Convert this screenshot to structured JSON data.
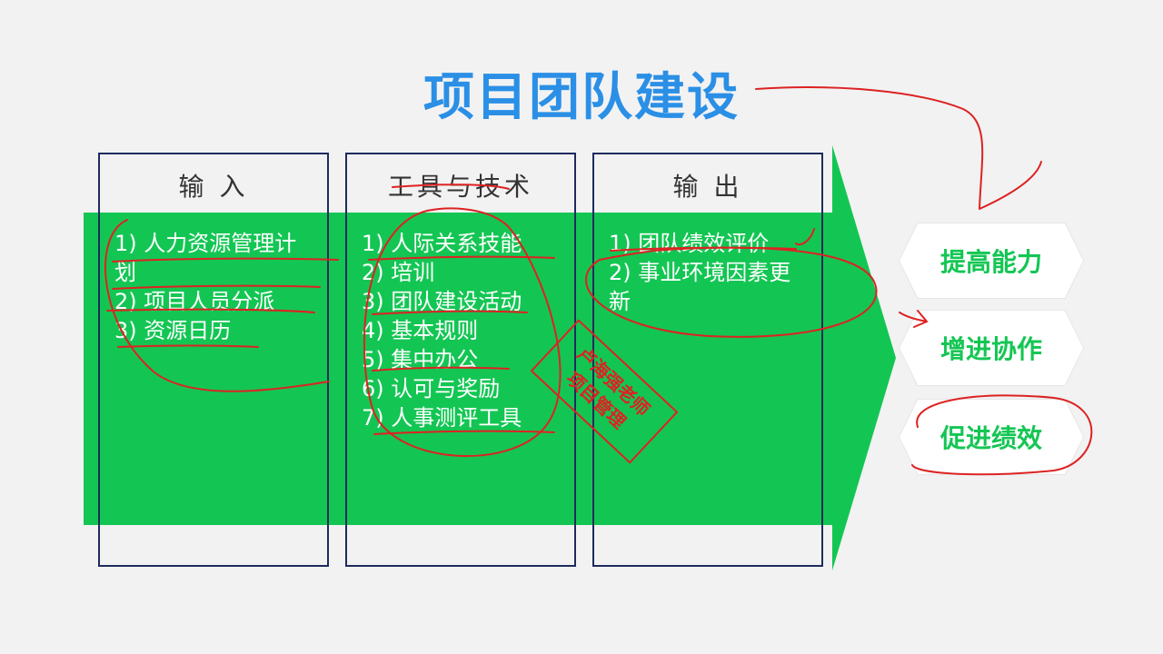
{
  "title": "项目团队建设",
  "columns": [
    {
      "header": "输 入",
      "items": [
        "1) 人力资源管理计划",
        "2) 项目人员分派",
        "3) 资源日历"
      ]
    },
    {
      "header": "工具与技术",
      "items": [
        "1) 人际关系技能",
        "2) 培训",
        "3) 团队建设活动",
        "4) 基本规则",
        "5) 集中办公",
        "6) 认可与奖励",
        "7) 人事测评工具"
      ]
    },
    {
      "header": "输 出",
      "items": [
        "1) 团队绩效评价",
        "2) 事业环境因素更新"
      ]
    }
  ],
  "outcomes": [
    "提高能力",
    "增进协作",
    "促进绩效"
  ],
  "stamp": {
    "line1": "卢海强老师",
    "line2": "项目管理"
  },
  "colors": {
    "title": "#2b8fe6",
    "arrow": "#13c653",
    "border": "#1e2b5e",
    "annotation": "#d22"
  }
}
